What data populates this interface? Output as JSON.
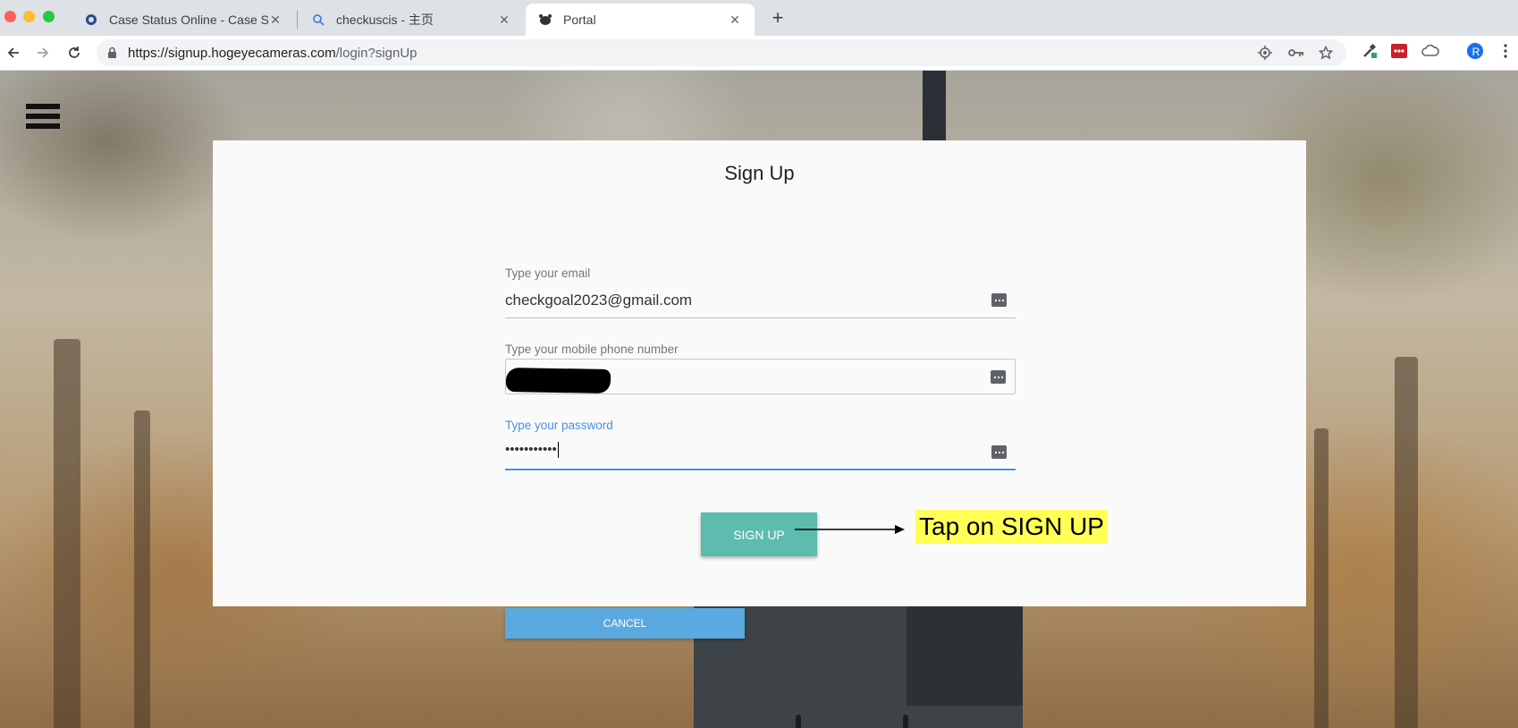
{
  "browser": {
    "tabs": [
      {
        "title": "Case Status Online - Case Stat",
        "icon": "uscis-seal-icon",
        "active": false
      },
      {
        "title": "checkuscis - 主页",
        "icon": "search-icon",
        "active": false
      },
      {
        "title": "Portal",
        "icon": "bear-logo-icon",
        "active": true
      }
    ],
    "url_host": "https://signup.hogeyecameras.com",
    "url_path": "/login?signUp",
    "profile_initial": "R",
    "colors": {
      "tabbar": "#dee1e6",
      "profile": "#1a73e8"
    }
  },
  "page": {
    "menu_icon": "hamburger-menu-icon",
    "form": {
      "title": "Sign Up",
      "email_label": "Type your email",
      "email_value": "checkgoal2023@gmail.com",
      "phone_label": "Type your mobile phone number",
      "password_label": "Type your password",
      "password_masked": "•••••••••••",
      "signup_label": "SIGN UP",
      "cancel_label": "CANCEL"
    },
    "annotation": "Tap on SIGN UP",
    "colors": {
      "signup_button": "#5dbcae",
      "cancel_button": "#5aa9e0",
      "focus": "#4a90e2",
      "annotation_bg": "#ffff55"
    }
  }
}
